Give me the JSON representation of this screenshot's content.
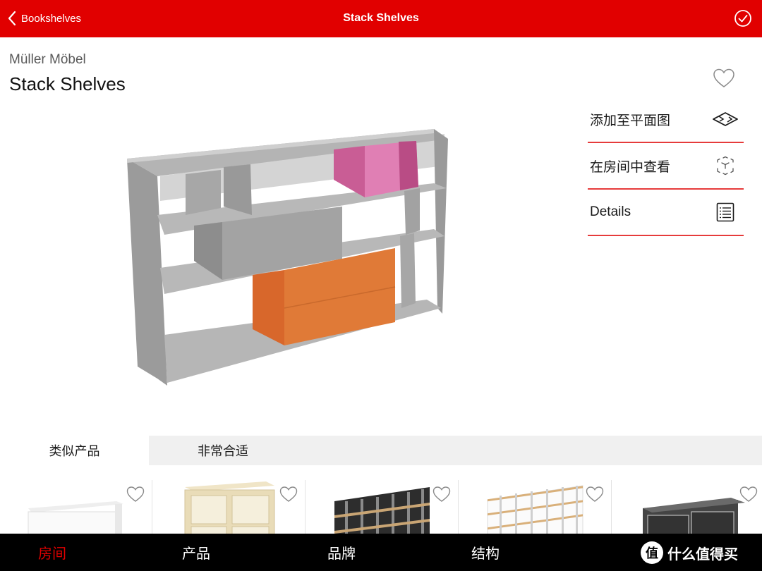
{
  "nav": {
    "back_label": "Bookshelves",
    "title": "Stack Shelves"
  },
  "product": {
    "brand": "Müller Möbel",
    "name": "Stack Shelves"
  },
  "actions": [
    {
      "label": "添加至平面图",
      "icon": "floorplan-icon"
    },
    {
      "label": "在房间中查看",
      "icon": "ar-cube-icon"
    },
    {
      "label": "Details",
      "icon": "details-list-icon"
    }
  ],
  "tabs": [
    {
      "label": "类似产品",
      "active": true
    },
    {
      "label": "非常合适",
      "active": false
    }
  ],
  "thumbnails": [
    {
      "icon": "white-sideboard-thumbnail"
    },
    {
      "icon": "wood-cube-shelf-thumbnail"
    },
    {
      "icon": "black-grid-shelf-thumbnail"
    },
    {
      "icon": "white-grid-shelf-thumbnail"
    },
    {
      "icon": "dark-low-shelf-thumbnail"
    }
  ],
  "bottom_nav": [
    {
      "label": "房间",
      "active": true
    },
    {
      "label": "产品",
      "active": false
    },
    {
      "label": "品牌",
      "active": false
    },
    {
      "label": "结构",
      "active": false
    }
  ],
  "watermark": {
    "text": "什么值得买",
    "badge": "值"
  },
  "colors": {
    "accent": "#e10000",
    "divider": "#e63b3b",
    "shelf_grey": "#a8a8a8",
    "pink_box": "#c95d95",
    "orange_box": "#e07a37"
  }
}
